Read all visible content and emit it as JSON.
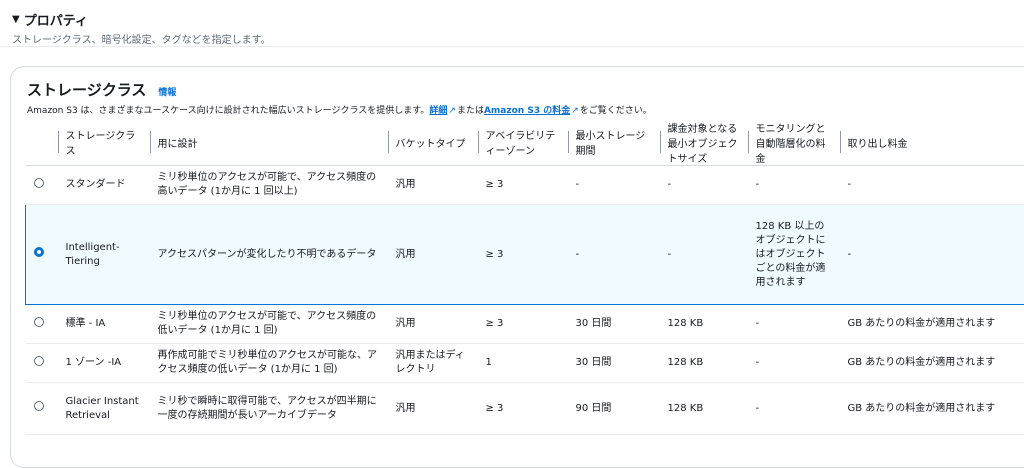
{
  "section": {
    "caret": "▼",
    "title": "プロパティ",
    "subtitle": "ストレージクラス、暗号化設定、タグなどを指定します。"
  },
  "panel": {
    "title": "ストレージクラス",
    "info": "情報",
    "desc_prefix": "Amazon S3 は、さまざまなユースケース向けに設計された幅広いストレージクラスを提供します。",
    "link_detail": "詳細",
    "desc_middle": "または",
    "link_pricing": "Amazon S3 の料金",
    "desc_suffix": "をご覧ください。"
  },
  "columns": [
    "ストレージクラス",
    "用に設計",
    "バケットタイプ",
    "アベイラビリティーゾーン",
    "最小ストレージ期間",
    "課金対象となる最小オブジェクトサイズ",
    "モニタリングと自動階層化の料金",
    "取り出し料金"
  ],
  "rows": [
    {
      "name": "スタンダード",
      "design": "ミリ秒単位のアクセスが可能で、アクセス頻度の高いデータ (1か月に 1 回以上)",
      "bucket": "汎用",
      "az": "≥ 3",
      "min_dur": "-",
      "min_size": "-",
      "monitor": "-",
      "retrieval": "-",
      "selected": false
    },
    {
      "name": "Intelligent-Tiering",
      "design": "アクセスパターンが変化したり不明であるデータ",
      "bucket": "汎用",
      "az": "≥ 3",
      "min_dur": "-",
      "min_size": "-",
      "monitor": "128 KB 以上のオブジェクトにはオブジェクトごとの料金が適用されます",
      "retrieval": "-",
      "selected": true
    },
    {
      "name": "標準 - IA",
      "design": "ミリ秒単位のアクセスが可能で、アクセス頻度の低いデータ (1か月に 1 回)",
      "bucket": "汎用",
      "az": "≥ 3",
      "min_dur": "30 日間",
      "min_size": "128 KB",
      "monitor": "-",
      "retrieval": "GB あたりの料金が適用されます",
      "selected": false
    },
    {
      "name": "1 ゾーン -IA",
      "design": "再作成可能でミリ秒単位のアクセスが可能な、アクセス頻度の低いデータ (1か月に 1 回)",
      "bucket": "汎用またはディレクトリ",
      "az": "1",
      "min_dur": "30 日間",
      "min_size": "128 KB",
      "monitor": "-",
      "retrieval": "GB あたりの料金が適用されます",
      "selected": false
    },
    {
      "name": "Glacier Instant Retrieval",
      "design": "ミリ秒で瞬時に取得可能で、アクセスが四半期に一度の存続期間が長いアーカイブデータ",
      "bucket": "汎用",
      "az": "≥ 3",
      "min_dur": "90 日間",
      "min_size": "128 KB",
      "monitor": "-",
      "retrieval": "GB あたりの料金が適用されます",
      "selected": false
    }
  ]
}
